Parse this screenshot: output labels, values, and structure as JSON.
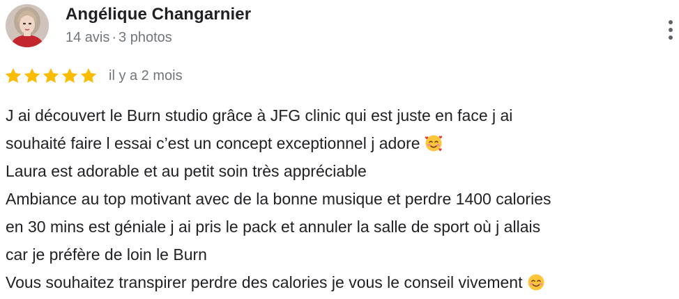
{
  "review": {
    "author": {
      "name": "Angélique Changarnier",
      "reviews_count": "14 avis",
      "separator": "·",
      "photos_count": "3 photos"
    },
    "rating": 5,
    "rating_max": 5,
    "date": "il y a 2 mois",
    "text_lines": [
      "J ai découvert le Burn studio grâce à JFG clinic qui est juste en face j ai",
      "souhaité faire l essai c’est un concept exceptionnel j adore",
      "Laura est adorable et au petit soin très appréciable",
      "Ambiance au top motivant avec de la bonne musique et perdre 1400 calories",
      "en 30 mins est géniale j ai pris le pack et annuler la salle de sport où j allais",
      "car je préfère de loin le Burn",
      "Vous souhaitez transpirer perdre des calories je vous le conseil vivement"
    ],
    "emojis": {
      "line_2": "smiling-face-with-hearts-icon",
      "line_7": "smiling-face-icon"
    },
    "icons": {
      "more": "more-vertical-icon",
      "star": "star-icon"
    },
    "colors": {
      "star": "#fbbc04",
      "name": "#202124",
      "meta": "#70757a"
    }
  }
}
